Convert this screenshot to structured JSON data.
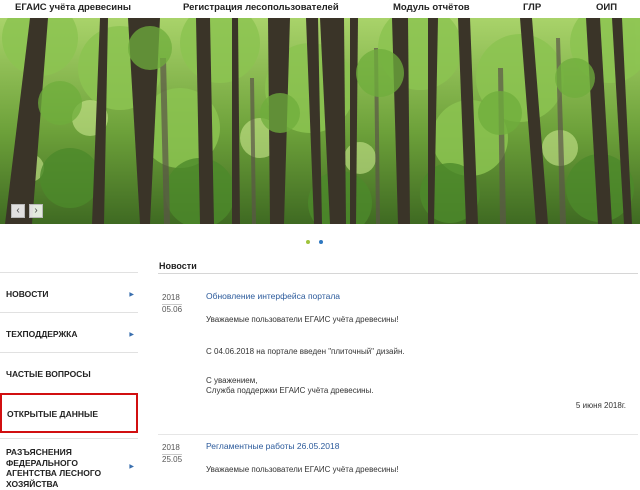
{
  "topnav": {
    "items": [
      "ЕГАИС учёта древесины",
      "Регистрация лесопользователей",
      "Модуль отчётов",
      "ГЛР",
      "ОИП"
    ]
  },
  "hero": {
    "prev_icon": "chevron-left-icon",
    "next_icon": "chevron-right-icon",
    "prev_glyph": "‹",
    "next_glyph": "›",
    "dot_colors": [
      "#9fc33c",
      "#2e78c0"
    ]
  },
  "sidebar": {
    "items": [
      {
        "label": "НОВОСТИ",
        "has_arrow": true
      },
      {
        "label": "ТЕХПОДДЕРЖКА",
        "has_arrow": true
      },
      {
        "label": "ЧАСТЫЕ ВОПРОСЫ",
        "has_arrow": false
      },
      {
        "label": "ОТКРЫТЫЕ ДАННЫЕ",
        "has_arrow": false
      },
      {
        "label": "РАЗЪЯСНЕНИЯ ФЕДЕРАЛЬНОГО АГЕНТСТВА ЛЕСНОГО ХОЗЯЙСТВА",
        "has_arrow": true
      }
    ],
    "arrow_glyph": "▶"
  },
  "main": {
    "section_title": "Новости",
    "news": [
      {
        "year": "2018",
        "daymonth": "05.06",
        "title": "Обновление интерфейса портала",
        "paragraphs": [
          "Уважаемые пользователи ЕГАИС учёта древесины!",
          "С 04.06.2018 на портале введен \"плиточный\" дизайн.",
          "С уважением,",
          "Служба поддержки ЕГАИС учёта древесины."
        ],
        "sign_date": "5 июня 2018г."
      },
      {
        "year": "2018",
        "daymonth": "25.05",
        "title": "Регламентные работы 26.05.2018",
        "paragraphs": [
          "Уважаемые пользователи ЕГАИС учёта древесины!"
        ]
      }
    ]
  },
  "colors": {
    "link": "#2b5a9b",
    "highlight_border": "#d10f10",
    "arrow": "#3a6fae"
  }
}
